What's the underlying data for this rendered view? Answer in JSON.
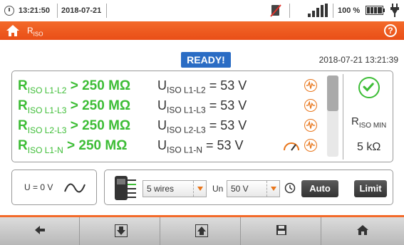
{
  "status": {
    "time": "13:21:50",
    "date": "2018-07-21",
    "battery_pct": "100 %"
  },
  "title": {
    "main": "R",
    "sub": "ISO",
    "help": "?"
  },
  "ready": "READY!",
  "datetime": "2018-07-21 13:21:39",
  "results": [
    {
      "r_main": "R",
      "r_sub": "ISO L1-L2",
      "r_val": " > 250 MΩ",
      "u_main": "U",
      "u_sub": "ISO L1-L2",
      "u_val": " = 53 V"
    },
    {
      "r_main": "R",
      "r_sub": "ISO L1-L3",
      "r_val": " > 250 MΩ",
      "u_main": "U",
      "u_sub": "ISO L1-L3",
      "u_val": " = 53 V"
    },
    {
      "r_main": "R",
      "r_sub": "ISO L2-L3",
      "r_val": " > 250 MΩ",
      "u_main": "U",
      "u_sub": "ISO L2-L3",
      "u_val": " = 53 V"
    },
    {
      "r_main": "R",
      "r_sub": "ISO L1-N",
      "r_val": " > 250 MΩ",
      "u_main": "U",
      "u_sub": "ISO L1-N",
      "u_val": " = 53 V"
    }
  ],
  "rmin": {
    "label_main": "R",
    "label_sub": "ISO MIN",
    "value": "5 kΩ"
  },
  "controls": {
    "u_readout": "U = 0 V",
    "wires": "5 wires",
    "un_label": "Un",
    "un_value": "50 V",
    "auto_label": "Auto",
    "limit_label": "Limit"
  },
  "colors": {
    "accent": "#f36a2a",
    "pass": "#3dbd36",
    "ready": "#2a6cc4"
  }
}
